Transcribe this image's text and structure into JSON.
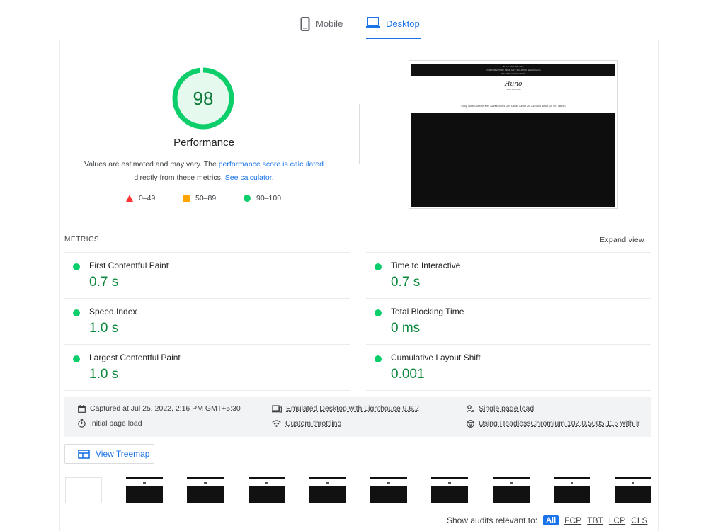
{
  "tabs": {
    "mobile": "Mobile",
    "desktop": "Desktop"
  },
  "score": {
    "value": 98,
    "fraction": 0.98,
    "title": "Performance"
  },
  "description": {
    "part1": "Values are estimated and may vary. The ",
    "link1": "performance score is calculated",
    "part2": "directly from these metrics. ",
    "link2": "See calculator."
  },
  "legend": {
    "fail": "0–49",
    "average": "50–89",
    "pass": "90–100"
  },
  "screenshot": {
    "topbar_line1": "BUY 1 GET 30% OFF",
    "topbar_line2": "COMPLIMENTARY FREE GIFT & CUSTOM ENGRAVING",
    "topbar_line3": "SEE OUR COLLECTIONS",
    "logo": "Huno",
    "logo_sub": "CRAFTOLOGY",
    "nav": "Shop Now   Custom Kits   Accessories   Gift Cards   About Us   Account   What Us On Twitch"
  },
  "metrics": {
    "header": "METRICS",
    "expand": "Expand view",
    "items": [
      {
        "name": "First Contentful Paint",
        "value": "0.7 s"
      },
      {
        "name": "Time to Interactive",
        "value": "0.7 s"
      },
      {
        "name": "Speed Index",
        "value": "1.0 s"
      },
      {
        "name": "Total Blocking Time",
        "value": "0 ms"
      },
      {
        "name": "Largest Contentful Paint",
        "value": "1.0 s"
      },
      {
        "name": "Cumulative Layout Shift",
        "value": "0.001"
      }
    ]
  },
  "info": {
    "captured": "Captured at Jul 25, 2022, 2:16 PM GMT+5:30",
    "emulated": "Emulated Desktop with Lighthouse 9.6.2",
    "single": "Single page load",
    "initial": "Initial page load",
    "throttling": "Custom throttling",
    "browser": "Using HeadlessChromium 102.0.5005.115 with lr"
  },
  "treemap": {
    "label": "View Treemap"
  },
  "audits": {
    "label": "Show audits relevant to:",
    "filters": [
      "All",
      "FCP",
      "TBT",
      "LCP",
      "CLS"
    ]
  },
  "colors": {
    "pass": "#0cce6b",
    "average": "#ffa400",
    "fail": "#ff3333",
    "link": "#1a73e8"
  }
}
